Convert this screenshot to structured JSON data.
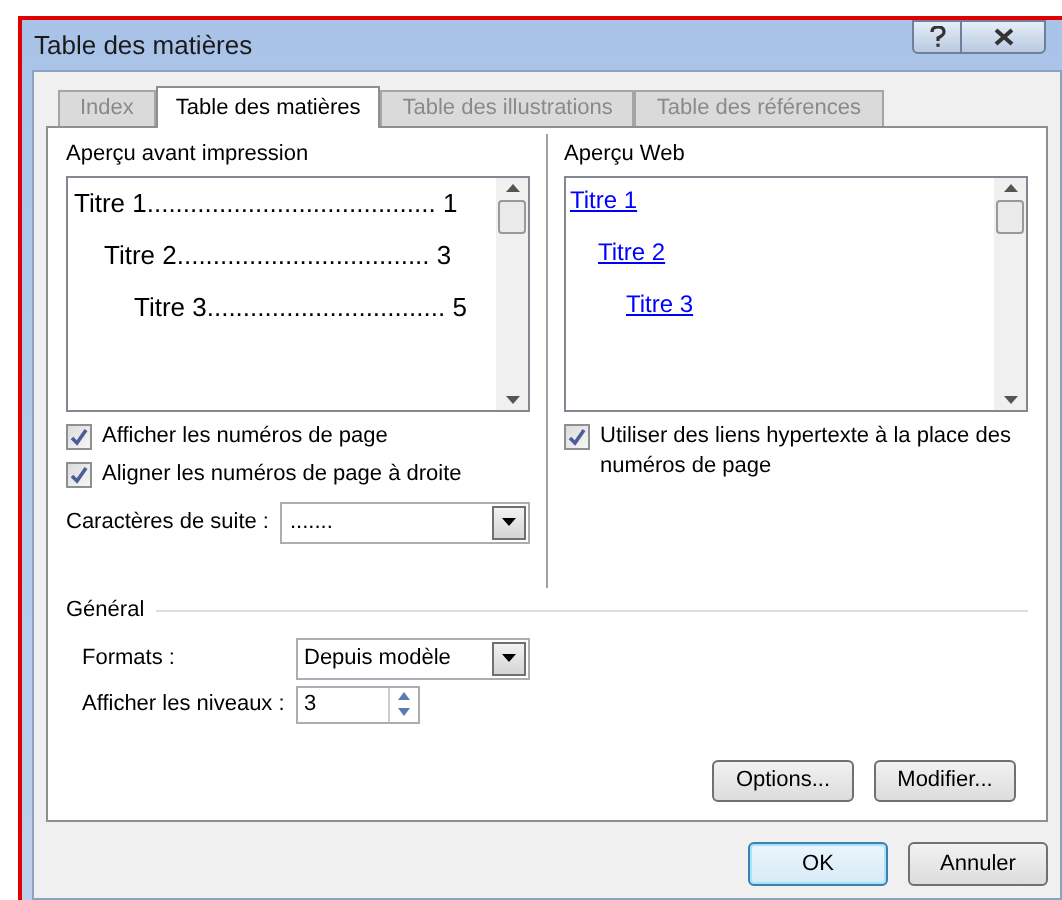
{
  "window": {
    "title": "Table des matières"
  },
  "tabs": [
    {
      "label": "Index",
      "selected": false
    },
    {
      "label": "Table des matières",
      "selected": true
    },
    {
      "label": "Table des illustrations",
      "selected": false
    },
    {
      "label": "Table des références",
      "selected": false
    }
  ],
  "print_preview": {
    "label": "Aperçu avant impression",
    "entries": [
      {
        "label": "Titre 1",
        "leader": "........................................",
        "page": "1",
        "children": [
          {
            "label": "Titre 2",
            "leader": "...................................",
            "page": "3",
            "children": [
              {
                "label": "Titre 3",
                "leader": ".................................",
                "page": "5"
              }
            ]
          }
        ]
      }
    ]
  },
  "web_preview": {
    "label": "Aperçu Web",
    "entries": [
      {
        "label": "Titre 1",
        "children": [
          {
            "label": "Titre 2",
            "children": [
              {
                "label": "Titre 3"
              }
            ]
          }
        ]
      }
    ]
  },
  "print_options": [
    {
      "label": "Afficher les numéros de page",
      "checked": true
    },
    {
      "label": "Aligner les numéros de page à droite",
      "checked": true
    }
  ],
  "leader_field": {
    "label": "Caractères de suite :",
    "value": "......."
  },
  "web_options": [
    {
      "label": "Utiliser des liens hypertexte à la place des numéros de page",
      "checked": true
    }
  ],
  "general": {
    "title": "Général",
    "formats": {
      "label": "Formats :",
      "value": "Depuis modèle"
    },
    "levels": {
      "label": "Afficher les niveaux :",
      "value": "3"
    }
  },
  "panel_buttons": [
    "Options...",
    "Modifier..."
  ],
  "dialog_buttons": [
    {
      "label": "OK",
      "default": true
    },
    {
      "label": "Annuler",
      "default": false
    }
  ]
}
